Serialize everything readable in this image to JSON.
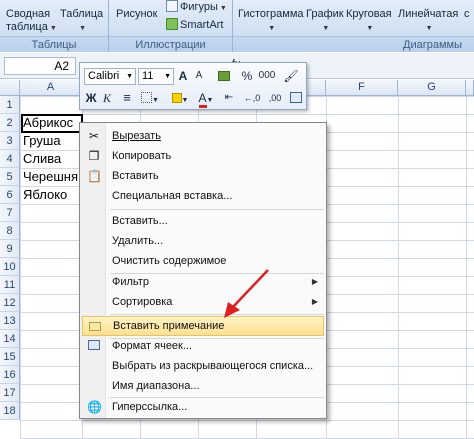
{
  "ribbon": {
    "pivot_label_1": "Сводная",
    "pivot_label_2": "таблица",
    "table_label": "Таблица",
    "picture_label": "Рисунок",
    "shapes_label": "Фигуры",
    "smartart_label": "SmartArt",
    "histogram_label": "Гистограмма",
    "graph_label": "График",
    "pie_label": "Круговая",
    "linear_label": "Линейчатая",
    "other_label_partial": "с",
    "group_tables": "Таблицы",
    "group_illustrations": "Иллюстрации",
    "group_charts": "Диаграммы"
  },
  "namebar": {
    "cell_ref": "A2",
    "fx_partial": "fx"
  },
  "sheet": {
    "columns": [
      "A",
      "B",
      "C",
      "D",
      "E",
      "F",
      "G"
    ],
    "rows": [
      "1",
      "2",
      "3",
      "4",
      "5",
      "6",
      "7",
      "8",
      "9",
      "10",
      "11",
      "12",
      "13",
      "14",
      "15",
      "16",
      "17",
      "18"
    ],
    "cells": [
      "Абрикос",
      "Груша",
      "Слива",
      "Черешня",
      "Яблоко"
    ]
  },
  "mini_toolbar": {
    "font_name": "Calibri",
    "font_size": "11",
    "percent": "%",
    "thousands": "000",
    "bold": "Ж",
    "italic": "К",
    "grow": "A",
    "shrink": "A",
    "font_color_letter": "A",
    "dec_inc": "←,0",
    "dec_dec": ",00"
  },
  "context_menu": {
    "items": [
      {
        "label": "Вырезать",
        "icon": "scissors-icon",
        "arrow": false
      },
      {
        "label": "Копировать",
        "icon": "copy-icon",
        "arrow": false
      },
      {
        "label": "Вставить",
        "icon": "paste-icon",
        "arrow": false
      },
      {
        "label": "Специальная вставка...",
        "icon": "",
        "arrow": false
      },
      {
        "label": "Вставить...",
        "icon": "",
        "arrow": false
      },
      {
        "label": "Удалить...",
        "icon": "",
        "arrow": false
      },
      {
        "label": "Очистить содержимое",
        "icon": "",
        "arrow": false
      },
      {
        "label": "Фильтр",
        "icon": "",
        "arrow": true
      },
      {
        "label": "Сортировка",
        "icon": "",
        "arrow": true
      },
      {
        "label": "Вставить примечание",
        "icon": "comment-icon",
        "arrow": false
      },
      {
        "label": "Формат ячеек...",
        "icon": "format-cells-icon",
        "arrow": false
      },
      {
        "label": "Выбрать из раскрывающегося списка...",
        "icon": "",
        "arrow": false
      },
      {
        "label": "Имя диапазона...",
        "icon": "",
        "arrow": false
      },
      {
        "label": "Гиперссылка...",
        "icon": "hyperlink-icon",
        "arrow": false
      }
    ],
    "highlight_color": "#fbe08f"
  },
  "annotation": {
    "arrow_color": "#e02020"
  }
}
